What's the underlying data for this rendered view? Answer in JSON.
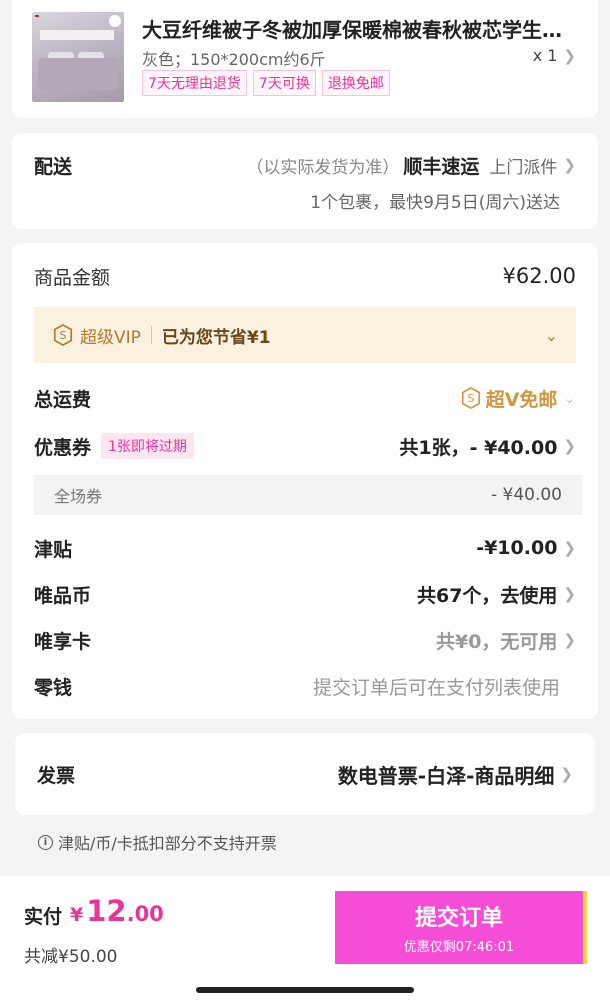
{
  "product": {
    "title": "大豆纤维被子冬被加厚保暖棉被春秋被芯学生宿舍",
    "spec": "灰色；150*200cm约6斤",
    "qty": "x 1",
    "tags": [
      "7天无理由退货",
      "7天可换",
      "退换免邮"
    ]
  },
  "delivery": {
    "label": "配送",
    "note": "（以实际发货为准）",
    "carrier": "顺丰速运",
    "pickup": "上门派件",
    "eta": "1个包裹，最快9月5日(周六)送达"
  },
  "amounts": {
    "goods_label": "商品金额",
    "goods_value": "¥62.00",
    "vip_name": "超级VIP",
    "vip_saving": "已为您节省¥1",
    "shipping_label": "总运费",
    "shipping_value": "超V免邮",
    "coupon_label": "优惠券",
    "coupon_badge": "1张即将过期",
    "coupon_value": "共1张，- ¥40.00",
    "coupon_sub_label": "全场券",
    "coupon_sub_value": "- ¥40.00",
    "allowance_label": "津贴",
    "allowance_value": "-¥10.00",
    "coin_label": "唯品币",
    "coin_value": "共67个，去使用",
    "card_label": "唯享卡",
    "card_value": "共¥0，无可用",
    "change_label": "零钱",
    "change_value": "提交订单后可在支付列表使用"
  },
  "invoice": {
    "label": "发票",
    "value": "数电普票-白泽-商品明细",
    "note": "津贴/币/卡抵扣部分不支持开票"
  },
  "bottom": {
    "pay_label": "实付",
    "currency": "¥",
    "pay_int": "12",
    "pay_dec": ".00",
    "saved": "共减¥50.00",
    "submit": "提交订单",
    "countdown": "优惠仅剩07:46:01"
  },
  "colors": {
    "accent": "#e8359a",
    "submit_bg": "#f64dd6",
    "gold": "#b07a2e",
    "vip_bg": "#fbf1df"
  }
}
